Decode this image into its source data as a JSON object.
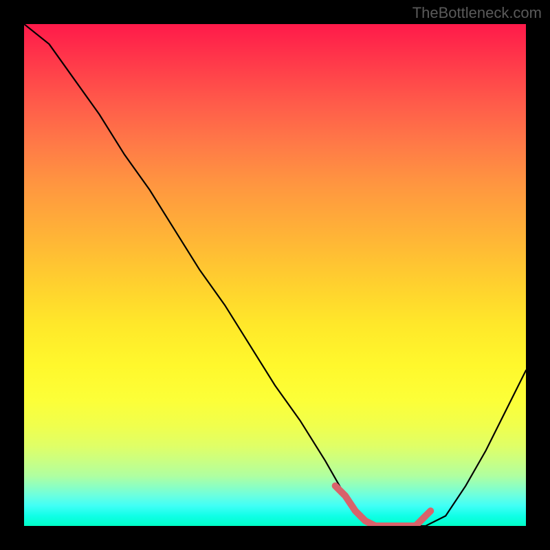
{
  "watermark": "TheBottleneck.com",
  "chart_data": {
    "type": "line",
    "title": "",
    "xlabel": "",
    "ylabel": "",
    "xlim": [
      0,
      100
    ],
    "ylim": [
      0,
      100
    ],
    "series": [
      {
        "name": "bottleneck-curve",
        "x": [
          0,
          5,
          10,
          15,
          20,
          25,
          30,
          35,
          40,
          45,
          50,
          55,
          60,
          64,
          68,
          72,
          76,
          80,
          84,
          88,
          92,
          96,
          100
        ],
        "values": [
          100,
          96,
          89,
          82,
          74,
          67,
          59,
          51,
          44,
          36,
          28,
          21,
          13,
          6,
          1,
          0,
          0,
          0,
          2,
          8,
          15,
          23,
          31
        ]
      }
    ],
    "highlight_segment": {
      "x": [
        62,
        64,
        66,
        68,
        70,
        72,
        74,
        76,
        78,
        80,
        81
      ],
      "values": [
        8,
        6,
        3,
        1,
        0,
        0,
        0,
        0,
        0,
        2,
        3
      ]
    },
    "gradient_stops": [
      {
        "pct": 0,
        "color": "#ff1a4a"
      },
      {
        "pct": 50,
        "color": "#ffd12e"
      },
      {
        "pct": 75,
        "color": "#fcff38"
      },
      {
        "pct": 100,
        "color": "#00ffc8"
      }
    ]
  }
}
